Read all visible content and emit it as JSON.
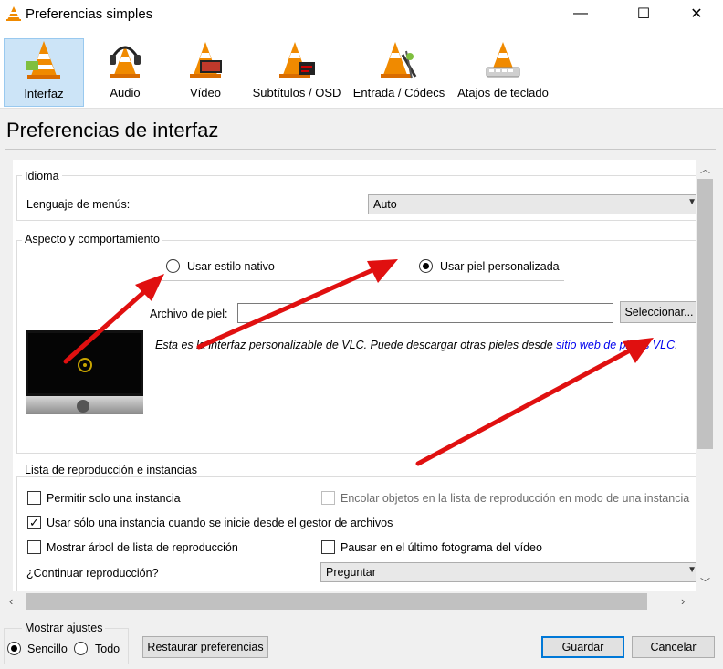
{
  "window": {
    "title": "Preferencias simples",
    "controls": [
      "—",
      "☐",
      "✕"
    ]
  },
  "toolbar": {
    "items": [
      {
        "label": "Interfaz",
        "icon": "vlc-cone-interface-icon",
        "active": true
      },
      {
        "label": "Audio",
        "icon": "vlc-cone-headphones-icon",
        "active": false
      },
      {
        "label": "Vídeo",
        "icon": "vlc-cone-video-icon",
        "active": false
      },
      {
        "label": "Subtítulos / OSD",
        "icon": "vlc-cone-subtitles-icon",
        "active": false
      },
      {
        "label": "Entrada / Códecs",
        "icon": "vlc-cone-codecs-icon",
        "active": false
      },
      {
        "label": "Atajos de teclado",
        "icon": "vlc-cone-hotkeys-icon",
        "active": false
      }
    ]
  },
  "page": {
    "title": "Preferencias de interfaz"
  },
  "idioma": {
    "group_title": "Idioma",
    "label": "Lenguaje de menús:",
    "value": "Auto"
  },
  "aspecto": {
    "group_title": "Aspecto y comportamiento",
    "radio_native": "Usar estilo nativo",
    "radio_custom": "Usar piel personalizada",
    "selected": "custom",
    "skin_label": "Archivo de piel:",
    "skin_value": "",
    "select_button": "Seleccionar...",
    "info_text": "Esta es la interfaz personalizable de VLC. Puede descargar otras pieles desde",
    "info_link": "sitio web de pieles VLC",
    "info_end": "."
  },
  "lista": {
    "group_title": "Lista de reproducción e instancias",
    "options": {
      "una_instancia": {
        "label": "Permitir solo una instancia",
        "checked": false
      },
      "encolar": {
        "label": "Encolar objetos en la lista de reproducción en modo de una instancia",
        "checked": false,
        "disabled": true
      },
      "gestor": {
        "label": "Usar sólo una instancia cuando se inicie desde el gestor de archivos",
        "checked": true
      },
      "arbol": {
        "label": "Mostrar árbol de lista de reproducción",
        "checked": false
      },
      "pausar": {
        "label": "Pausar en el último fotograma del vídeo",
        "checked": false
      }
    },
    "continuar_label": "¿Continuar reproducción?",
    "continuar_value": "Preguntar"
  },
  "footer": {
    "mostrar_title": "Mostrar ajustes",
    "sencillo": "Sencillo",
    "todo": "Todo",
    "selected": "sencillo",
    "restaurar": "Restaurar preferencias",
    "guardar": "Guardar",
    "cancelar": "Cancelar"
  },
  "annotations": {
    "arrow_color": "#e01010"
  },
  "colors": {
    "accent_border": "#0078d7",
    "link": "#0000ee",
    "selection_bg": "#cce4f7"
  }
}
